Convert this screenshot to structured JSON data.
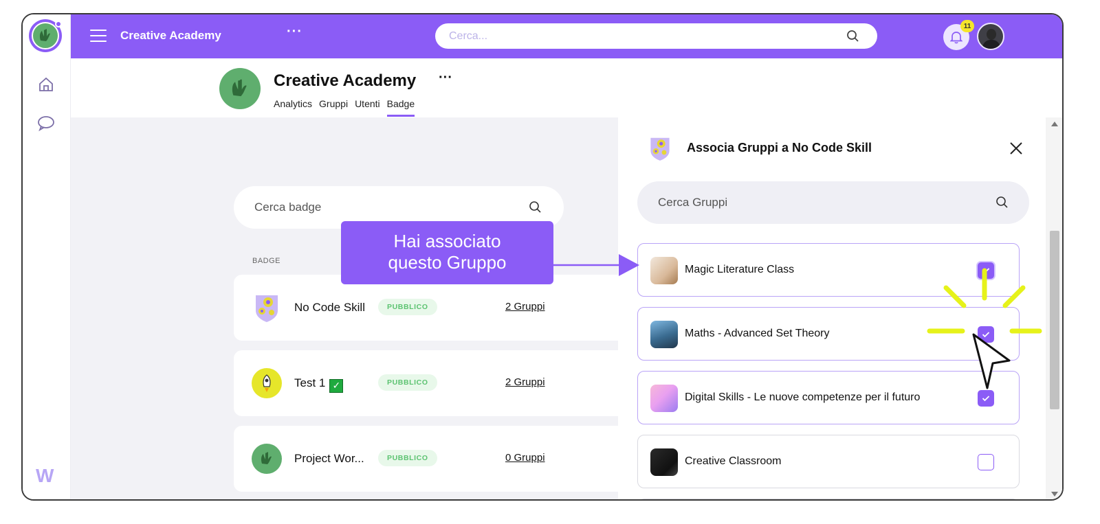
{
  "topbar": {
    "app_title": "Creative Academy",
    "more": "···",
    "search_placeholder": "Cerca...",
    "notifications_count": "11"
  },
  "org": {
    "name": "Creative Academy",
    "more": "···",
    "tabs": [
      {
        "label": "Analytics"
      },
      {
        "label": "Gruppi"
      },
      {
        "label": "Utenti"
      },
      {
        "label": "Badge",
        "active": true
      }
    ]
  },
  "badges": {
    "search_placeholder": "Cerca badge",
    "column_header": "BADGE",
    "rows": [
      {
        "name": "No Code Skill",
        "visibility": "PUBBLICO",
        "groups": "2 Gruppi"
      },
      {
        "name": "Test 1",
        "visibility": "PUBBLICO",
        "groups": "2 Gruppi"
      },
      {
        "name": "Project Wor...",
        "visibility": "PUBBLICO",
        "groups": "0 Gruppi"
      }
    ]
  },
  "callout": {
    "line1": "Hai associato",
    "line2": "questo Gruppo"
  },
  "panel": {
    "title": "Associa Gruppi a No Code Skill",
    "search_placeholder": "Cerca Gruppi",
    "groups": [
      {
        "name": "Magic Literature Class",
        "checked": true
      },
      {
        "name": "Maths - Advanced Set Theory",
        "checked": true
      },
      {
        "name": "Digital Skills - Le nuove competenze per il futuro",
        "checked": true
      },
      {
        "name": "Creative Classroom",
        "checked": false
      }
    ]
  },
  "colors": {
    "brand": "#8b5cf6",
    "highlight": "#e6f21a",
    "public_pill": "#5cc371"
  }
}
